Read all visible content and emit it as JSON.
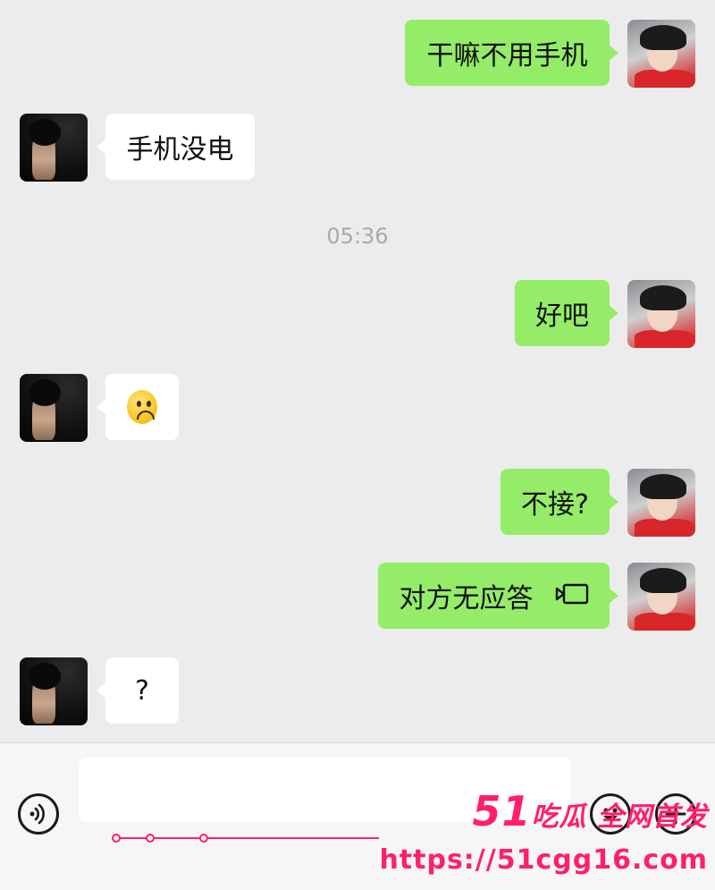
{
  "messages": [
    {
      "side": "me",
      "text": "干嘛不用手机"
    },
    {
      "side": "other",
      "text": "手机没电"
    },
    {
      "side": "me",
      "text": "好吧"
    },
    {
      "side": "other",
      "emoji": "frowning-face"
    },
    {
      "side": "me",
      "text": "不接?"
    },
    {
      "side": "me",
      "text": "对方无应答",
      "icon": "video-call-icon"
    },
    {
      "side": "other",
      "text": "?"
    }
  ],
  "timestamp": "05:36",
  "input": {
    "value": "",
    "placeholder": ""
  },
  "watermark": {
    "line1_num": "51",
    "line1_text": "吃瓜 全网首发",
    "line2": "https://51cgg16.com"
  },
  "colors": {
    "my_bubble": "#95ec69",
    "their_bubble": "#ffffff",
    "background": "#ececec",
    "watermark": "#ff1f6b"
  }
}
